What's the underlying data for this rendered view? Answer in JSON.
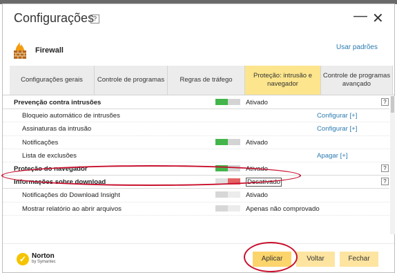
{
  "window": {
    "title": "Configurações",
    "help_symbol": "?",
    "minimize_symbol": "—",
    "close_symbol": "✕"
  },
  "header": {
    "section_title": "Firewall",
    "icon": "firewall-icon",
    "defaults_link": "Usar padrões"
  },
  "tabs": [
    {
      "label": "Configurações gerais",
      "active": false
    },
    {
      "label": "Controle de programas",
      "active": false
    },
    {
      "label": "Regras de tráfego",
      "active": false
    },
    {
      "label": "Proteção: intrusão e navegador",
      "active": true
    },
    {
      "label": "Controle de programas avançado",
      "active": false
    }
  ],
  "rows": [
    {
      "label": "Prevenção contra intrusões",
      "type": "section",
      "toggle": "on",
      "status": "Ativado",
      "help": "?"
    },
    {
      "label": "Bloqueio automático de intrusões",
      "type": "sub",
      "link": "Configurar [+]"
    },
    {
      "label": "Assinaturas da intrusão",
      "type": "sub",
      "link": "Configurar [+]"
    },
    {
      "label": "Notificações",
      "type": "sub",
      "toggle": "on",
      "status": "Ativado"
    },
    {
      "label": "Lista de exclusões",
      "type": "sub",
      "link": "Apagar [+]"
    },
    {
      "label": "Proteção do navegador",
      "type": "section",
      "toggle": "on",
      "status": "Ativado",
      "help": "?"
    },
    {
      "label": "Informações sobre download",
      "type": "section",
      "toggle": "off",
      "status": "Desativado",
      "help": "?",
      "highlight": true
    },
    {
      "label": "Notificações do Download Insight",
      "type": "sub",
      "toggle": "dis",
      "status": "Ativado"
    },
    {
      "label": "Mostrar relatório ao abrir arquivos",
      "type": "sub",
      "toggle": "dis",
      "status": "Apenas não comprovado"
    }
  ],
  "footer": {
    "brand": "Norton",
    "brand_sub": "by Symantec",
    "brand_icon": "norton-check-icon",
    "apply": "Aplicar",
    "back": "Voltar",
    "close": "Fechar"
  },
  "colors": {
    "active_tab": "#fce58c",
    "toggle_on": "#43b54a",
    "toggle_off": "#e46363",
    "link": "#2a7ab0",
    "annotation": "#c8102e"
  }
}
